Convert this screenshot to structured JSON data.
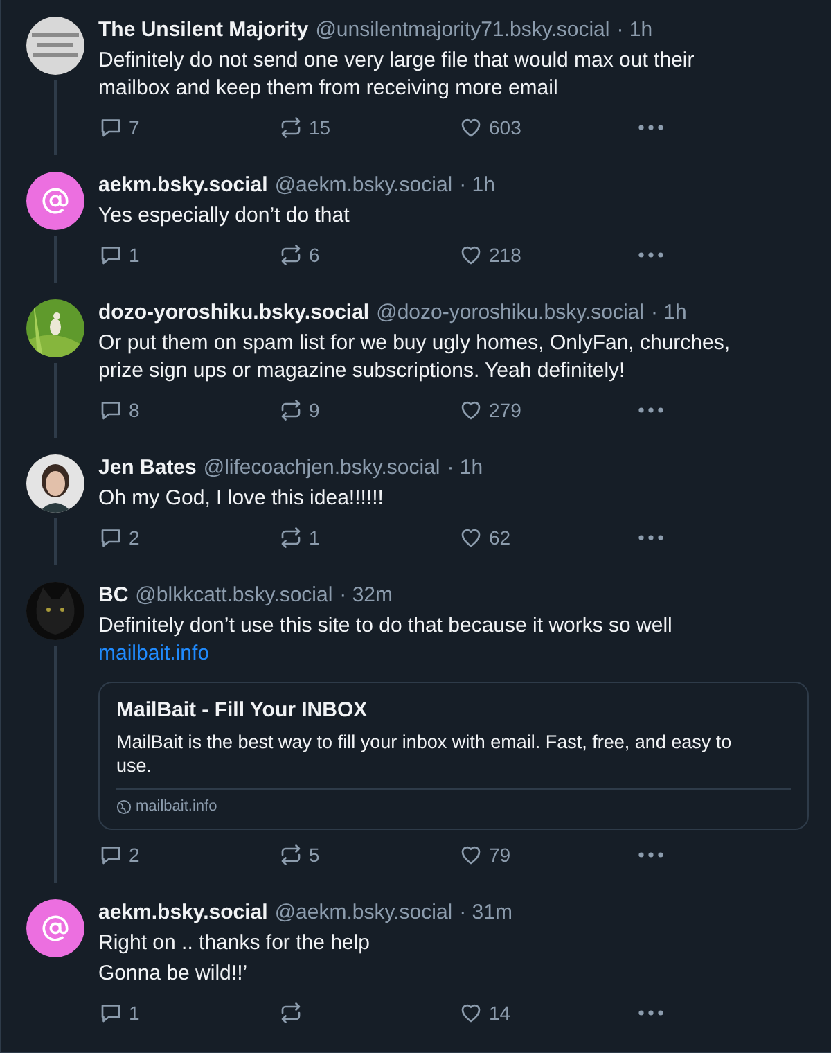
{
  "posts": [
    {
      "avatar": {
        "kind": "picture"
      },
      "name": "The Unsilent Majority",
      "handle": "@unsilentmajority71.bsky.social",
      "time": "· 1h",
      "lines": [
        "Definitely do not send one very large file that would max out their mailbox and keep them from receiving more email"
      ],
      "replies": "7",
      "reposts": "15",
      "likes": "603",
      "thread": true
    },
    {
      "avatar": {
        "kind": "default",
        "color": "#ec6fe0"
      },
      "name": "aekm.bsky.social",
      "handle": "@aekm.bsky.social",
      "time": "· 1h",
      "lines": [
        "Yes especially don’t do that"
      ],
      "replies": "1",
      "reposts": "6",
      "likes": "218",
      "thread": true
    },
    {
      "avatar": {
        "kind": "picture"
      },
      "name": "dozo-yoroshiku.bsky.social",
      "handle": "@dozo-yoroshiku.bsky.social",
      "time": "· 1h",
      "lines": [
        "Or put them on spam list for we buy ugly homes, OnlyFan, churches, prize sign ups or magazine subscriptions. Yeah definitely!"
      ],
      "replies": "8",
      "reposts": "9",
      "likes": "279",
      "thread": true
    },
    {
      "avatar": {
        "kind": "picture"
      },
      "name": "Jen Bates",
      "handle": "@lifecoachjen.bsky.social",
      "time": "· 1h",
      "lines": [
        "Oh my God, I love this idea!!!!!!"
      ],
      "replies": "2",
      "reposts": "1",
      "likes": "62",
      "thread": true
    },
    {
      "avatar": {
        "kind": "picture"
      },
      "name": "BC",
      "handle": "@blkkcatt.bsky.social",
      "time": "· 32m",
      "lines": [
        "Definitely don’t use this site to do that because it works so well"
      ],
      "link": "mailbait.info",
      "card": {
        "title": "MailBait - Fill Your INBOX",
        "description": "MailBait is the best way to fill your inbox with email.  Fast, free, and easy to use.",
        "domain": "mailbait.info"
      },
      "replies": "2",
      "reposts": "5",
      "likes": "79",
      "thread": true
    },
    {
      "avatar": {
        "kind": "default",
        "color": "#ec6fe0"
      },
      "name": "aekm.bsky.social",
      "handle": "@aekm.bsky.social",
      "time": "· 31m",
      "lines": [
        "Right on .. thanks for the help",
        "Gonna be wild!!’"
      ],
      "replies": "1",
      "likes": "14",
      "thread": false
    }
  ]
}
